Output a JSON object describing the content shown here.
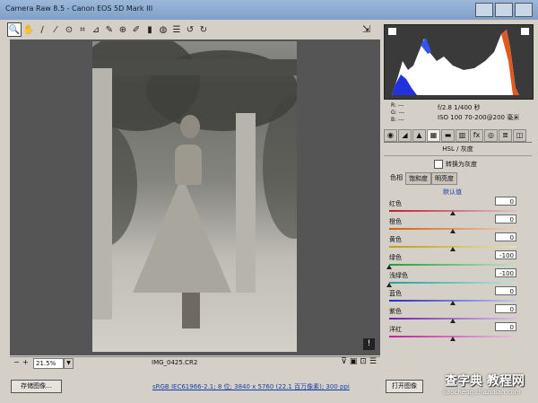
{
  "window": {
    "title": "Camera Raw 8.5 - Canon EOS 5D Mark III"
  },
  "toolbar": {
    "tools": [
      {
        "name": "zoom-tool-icon",
        "glyph": "🔍",
        "active": true
      },
      {
        "name": "hand-tool-icon",
        "glyph": "✋"
      },
      {
        "name": "white-balance-tool-icon",
        "glyph": "/"
      },
      {
        "name": "color-sampler-tool-icon",
        "glyph": "⁄"
      },
      {
        "name": "targeted-adjustment-tool-icon",
        "glyph": "⊙"
      },
      {
        "name": "crop-tool-icon",
        "glyph": "⌗"
      },
      {
        "name": "straighten-tool-icon",
        "glyph": "⊿"
      },
      {
        "name": "spot-removal-tool-icon",
        "glyph": "✎"
      },
      {
        "name": "red-eye-tool-icon",
        "glyph": "⊕"
      },
      {
        "name": "adjustment-brush-icon",
        "glyph": "✐"
      },
      {
        "name": "graduated-filter-icon",
        "glyph": "▮"
      },
      {
        "name": "radial-filter-icon",
        "glyph": "◍"
      },
      {
        "name": "preferences-icon",
        "glyph": "☰"
      },
      {
        "name": "rotate-left-icon",
        "glyph": "↺"
      },
      {
        "name": "rotate-right-icon",
        "glyph": "↻"
      }
    ],
    "fullscreen_glyph": "⇲"
  },
  "statusbar": {
    "zoom_minus": "−",
    "zoom_plus": "+",
    "zoom_value": "21.5%",
    "filename": "IMG_0425.CR2"
  },
  "info": {
    "rgb_labels": [
      "R: ---",
      "G: ---",
      "B: ---"
    ],
    "exif_line1": "f/2.8  1/400 秒",
    "exif_line2": "ISO 100  70-200@200 毫米"
  },
  "panel": {
    "section_title": "HSL / 灰度",
    "convert_label": "转换为灰度",
    "subtabs": [
      "色相",
      "饱和度",
      "明亮度"
    ],
    "auto_label": "默认值",
    "sliders": [
      {
        "label": "红色",
        "value": "0",
        "pos": 0.5,
        "grad": "linear-gradient(90deg,#c02030,#e0c0c8)"
      },
      {
        "label": "橙色",
        "value": "0",
        "pos": 0.5,
        "grad": "linear-gradient(90deg,#d06010,#e8d0b8)"
      },
      {
        "label": "黄色",
        "value": "0",
        "pos": 0.5,
        "grad": "linear-gradient(90deg,#c0a010,#e8e0b0)"
      },
      {
        "label": "绿色",
        "value": "-100",
        "pos": 0.0,
        "grad": "linear-gradient(90deg,#20a030,#c0e0c0)"
      },
      {
        "label": "浅绿色",
        "value": "-100",
        "pos": 0.0,
        "grad": "linear-gradient(90deg,#20a0a0,#c0e0e0)"
      },
      {
        "label": "蓝色",
        "value": "0",
        "pos": 0.5,
        "grad": "linear-gradient(90deg,#2030c0,#c0c8e8)"
      },
      {
        "label": "紫色",
        "value": "0",
        "pos": 0.5,
        "grad": "linear-gradient(90deg,#7020b0,#d8c0e8)"
      },
      {
        "label": "洋红",
        "value": "0",
        "pos": 0.5,
        "grad": "linear-gradient(90deg,#c020a0,#e8c0e0)"
      }
    ]
  },
  "footer": {
    "save_label": "存储图像...",
    "workflow_link": "sRGB IEC61966-2.1; 8 位; 3840 x 5760 (22.1 百万像素); 300 ppi",
    "open_label": "打开图像"
  },
  "watermark": {
    "line1": "查字典 教程网",
    "line2": "jiaocheng.chazidian.com"
  }
}
